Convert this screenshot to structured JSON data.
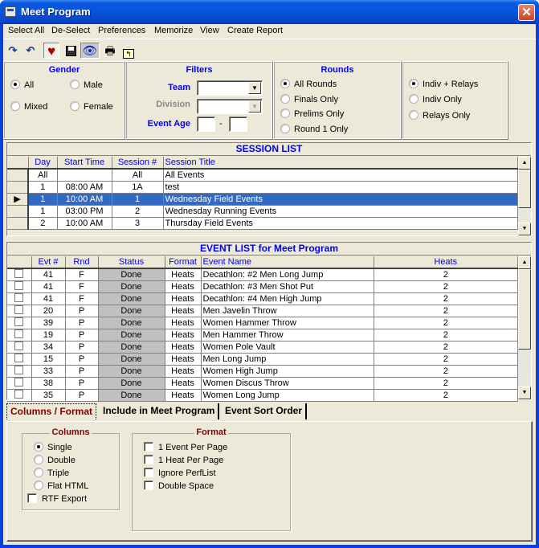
{
  "window": {
    "title": "Meet Program",
    "close_glyph": "✕"
  },
  "menu": [
    "Select All",
    "De-Select",
    "Preferences",
    "Memorize",
    "View",
    "Create Report"
  ],
  "toolbar": {
    "icons": [
      "redo-icon",
      "undo-icon",
      "heart-icon",
      "save-icon",
      "eye-icon",
      "print-icon",
      "folder-up-icon"
    ],
    "glyphs": [
      "↷",
      "↶",
      "♥",
      "💾",
      "👁",
      "🖶",
      "⮤"
    ]
  },
  "gender": {
    "title": "Gender",
    "options": [
      {
        "label": "All",
        "selected": true
      },
      {
        "label": "Male",
        "selected": false
      },
      {
        "label": "Mixed",
        "selected": false
      },
      {
        "label": "Female",
        "selected": false
      }
    ]
  },
  "filters": {
    "title": "Filters",
    "team_label": "Team",
    "team_value": "",
    "division_label": "Division",
    "division_value": "",
    "event_age_label": "Event Age",
    "age_from": "",
    "age_sep": "-",
    "age_to": "",
    "arrow": "▼"
  },
  "rounds": {
    "title": "Rounds",
    "options": [
      {
        "label": "All Rounds",
        "selected": true
      },
      {
        "label": "Finals Only",
        "selected": false
      },
      {
        "label": "Prelims Only",
        "selected": false
      },
      {
        "label": "Round 1 Only",
        "selected": false
      }
    ]
  },
  "event_type": {
    "options": [
      {
        "label": "Indiv + Relays",
        "selected": true
      },
      {
        "label": "Indiv Only",
        "selected": false
      },
      {
        "label": "Relays Only",
        "selected": false
      }
    ]
  },
  "session_list": {
    "caption": "SESSION LIST",
    "columns": [
      "Day",
      "Start Time",
      "Session #",
      "Session Title"
    ],
    "selected_marker": "▶",
    "rows": [
      {
        "day": "All",
        "start": "",
        "session": "All",
        "title": "All Events",
        "selected": false
      },
      {
        "day": "1",
        "start": "08:00 AM",
        "session": "1A",
        "title": "test",
        "selected": false
      },
      {
        "day": "1",
        "start": "10:00 AM",
        "session": "1",
        "title": "Wednesday Field Events",
        "selected": true
      },
      {
        "day": "1",
        "start": "03:00 PM",
        "session": "2",
        "title": "Wednesday Running Events",
        "selected": false
      },
      {
        "day": "2",
        "start": "10:00 AM",
        "session": "3",
        "title": "Thursday Field Events",
        "selected": false
      }
    ]
  },
  "event_list": {
    "caption": "EVENT LIST for Meet Program",
    "columns": [
      "Evt #",
      "Rnd",
      "Status",
      "Format",
      "Event Name",
      "Heats"
    ],
    "rows": [
      {
        "evt": "41",
        "rnd": "F",
        "status": "Done",
        "format": "Heats",
        "name": "Decathlon: #2 Men Long Jump",
        "heats": "2"
      },
      {
        "evt": "41",
        "rnd": "F",
        "status": "Done",
        "format": "Heats",
        "name": "Decathlon: #3 Men Shot Put",
        "heats": "2"
      },
      {
        "evt": "41",
        "rnd": "F",
        "status": "Done",
        "format": "Heats",
        "name": "Decathlon: #4 Men High Jump",
        "heats": "2"
      },
      {
        "evt": "20",
        "rnd": "P",
        "status": "Done",
        "format": "Heats",
        "name": "Men Javelin Throw",
        "heats": "2"
      },
      {
        "evt": "39",
        "rnd": "P",
        "status": "Done",
        "format": "Heats",
        "name": "Women Hammer Throw",
        "heats": "2"
      },
      {
        "evt": "19",
        "rnd": "P",
        "status": "Done",
        "format": "Heats",
        "name": "Men Hammer Throw",
        "heats": "2"
      },
      {
        "evt": "34",
        "rnd": "P",
        "status": "Done",
        "format": "Heats",
        "name": "Women Pole Vault",
        "heats": "2"
      },
      {
        "evt": "15",
        "rnd": "P",
        "status": "Done",
        "format": "Heats",
        "name": "Men Long Jump",
        "heats": "2"
      },
      {
        "evt": "33",
        "rnd": "P",
        "status": "Done",
        "format": "Heats",
        "name": "Women High Jump",
        "heats": "2"
      },
      {
        "evt": "38",
        "rnd": "P",
        "status": "Done",
        "format": "Heats",
        "name": "Women Discus Throw",
        "heats": "2"
      },
      {
        "evt": "35",
        "rnd": "P",
        "status": "Done",
        "format": "Heats",
        "name": "Women Long Jump",
        "heats": "2"
      }
    ]
  },
  "scroll": {
    "up": "▲",
    "down": "▼"
  },
  "tabs": [
    {
      "label": "Columns / Format",
      "active": true
    },
    {
      "label": "Include in Meet Program",
      "active": false
    },
    {
      "label": "Event Sort Order",
      "active": false
    }
  ],
  "columns_group": {
    "title": "Columns",
    "options": [
      {
        "label": "Single",
        "selected": true
      },
      {
        "label": "Double",
        "selected": false
      },
      {
        "label": "Triple",
        "selected": false
      },
      {
        "label": "Flat HTML",
        "selected": false
      }
    ],
    "rtf_label": "RTF Export",
    "rtf_checked": false
  },
  "format_group": {
    "title": "Format",
    "options": [
      {
        "label": "1 Event Per Page",
        "checked": false
      },
      {
        "label": "1 Heat Per Page",
        "checked": false
      },
      {
        "label": "Ignore PerfList",
        "checked": false
      },
      {
        "label": "Double Space",
        "checked": false
      }
    ]
  }
}
